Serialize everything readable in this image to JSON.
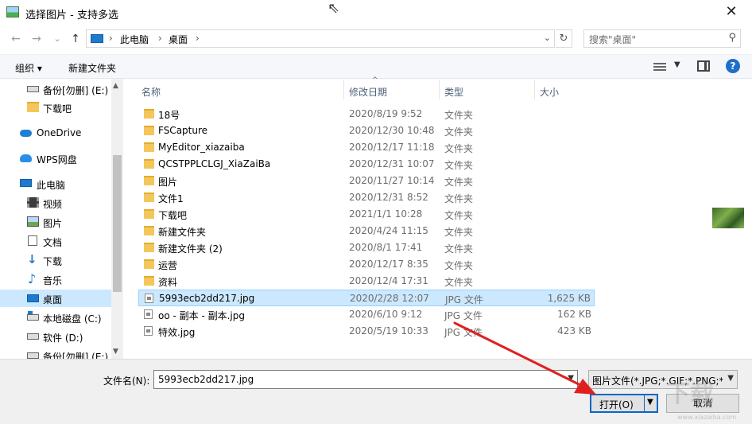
{
  "window": {
    "title": "选择图片 - 支持多选",
    "close_glyph": "✕"
  },
  "nav": {
    "back": "←",
    "forward": "→",
    "recent": "⌄",
    "up": "↑"
  },
  "address": {
    "crumbs": [
      "此电脑",
      "桌面"
    ],
    "sep": "›",
    "refresh": "↻",
    "search_placeholder": "搜索\"桌面\""
  },
  "toolbar": {
    "organize": "组织 ▾",
    "new_folder": "新建文件夹",
    "help": "?"
  },
  "sidebar": {
    "items": [
      {
        "label": "备份[勿删] (E:)",
        "icon": "drive-icon"
      },
      {
        "label": "下载吧",
        "icon": "folder-icon"
      },
      {
        "label": "OneDrive",
        "icon": "cloud-icon"
      },
      {
        "label": "WPS网盘",
        "icon": "wps-cloud-icon"
      },
      {
        "label": "此电脑",
        "icon": "computer-icon"
      },
      {
        "label": "视频",
        "icon": "video-icon"
      },
      {
        "label": "图片",
        "icon": "pictures-icon"
      },
      {
        "label": "文档",
        "icon": "documents-icon"
      },
      {
        "label": "下载",
        "icon": "download-icon"
      },
      {
        "label": "音乐",
        "icon": "music-icon"
      },
      {
        "label": "桌面",
        "icon": "desktop-icon",
        "selected": true
      },
      {
        "label": "本地磁盘 (C:)",
        "icon": "system-drive-icon"
      },
      {
        "label": "软件 (D:)",
        "icon": "drive-icon"
      },
      {
        "label": "备份[勿删] (E:)",
        "icon": "drive-icon"
      }
    ]
  },
  "columns": {
    "name": "名称",
    "date": "修改日期",
    "type": "类型",
    "size": "大小"
  },
  "files": [
    {
      "name": "18号",
      "date": "2020/8/19 9:52",
      "type": "文件夹",
      "size": "",
      "kind": "folder"
    },
    {
      "name": "FSCapture",
      "date": "2020/12/30 10:48",
      "type": "文件夹",
      "size": "",
      "kind": "folder"
    },
    {
      "name": "MyEditor_xiazaiba",
      "date": "2020/12/17 11:18",
      "type": "文件夹",
      "size": "",
      "kind": "folder"
    },
    {
      "name": "QCSTPPLCLGJ_XiaZaiBa",
      "date": "2020/12/31 10:07",
      "type": "文件夹",
      "size": "",
      "kind": "folder"
    },
    {
      "name": "图片",
      "date": "2020/11/27 10:14",
      "type": "文件夹",
      "size": "",
      "kind": "folder"
    },
    {
      "name": "文件1",
      "date": "2020/12/31 8:52",
      "type": "文件夹",
      "size": "",
      "kind": "folder"
    },
    {
      "name": "下载吧",
      "date": "2021/1/1 10:28",
      "type": "文件夹",
      "size": "",
      "kind": "folder"
    },
    {
      "name": "新建文件夹",
      "date": "2020/4/24 11:15",
      "type": "文件夹",
      "size": "",
      "kind": "folder"
    },
    {
      "name": "新建文件夹 (2)",
      "date": "2020/8/1 17:41",
      "type": "文件夹",
      "size": "",
      "kind": "folder"
    },
    {
      "name": "运营",
      "date": "2020/12/17 8:35",
      "type": "文件夹",
      "size": "",
      "kind": "folder"
    },
    {
      "name": "资料",
      "date": "2020/12/4 17:31",
      "type": "文件夹",
      "size": "",
      "kind": "folder"
    },
    {
      "name": "5993ecb2dd217.jpg",
      "date": "2020/2/28 12:07",
      "type": "JPG 文件",
      "size": "1,625 KB",
      "kind": "jpg",
      "selected": true
    },
    {
      "name": "oo - 副本 - 副本.jpg",
      "date": "2020/6/10 9:12",
      "type": "JPG 文件",
      "size": "162 KB",
      "kind": "jpg"
    },
    {
      "name": "特效.jpg",
      "date": "2020/5/19 10:33",
      "type": "JPG 文件",
      "size": "423 KB",
      "kind": "jpg"
    }
  ],
  "bottom": {
    "filename_label": "文件名(N):",
    "filename_value": "5993ecb2dd217.jpg",
    "filter_value": "图片文件(*.JPG;*.GIF;*.PNG;*.B",
    "open_label": "打开(O)",
    "cancel_label": "取消",
    "dropdown_glyph": "⌄"
  },
  "colors": {
    "accent": "#0a64c8",
    "selection": "#cce8ff",
    "annotation": "#e02020"
  },
  "watermark": {
    "text": "下载",
    "url": "www.xiazaiba.com"
  }
}
